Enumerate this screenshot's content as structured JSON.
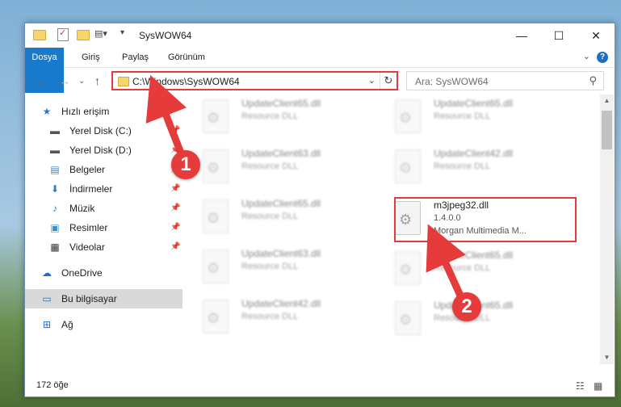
{
  "window": {
    "title": "SysWOW64",
    "controls": {
      "minimize": "—",
      "maximize": "☐",
      "close": "✕"
    }
  },
  "ribbon": {
    "tabs": [
      "Dosya",
      "Giriş",
      "Paylaş",
      "Görünüm"
    ],
    "help": "?"
  },
  "address": {
    "path": "C:\\Windows\\SysWOW64",
    "search_placeholder": "Ara: SysWOW64"
  },
  "sidebar": {
    "quick_access": "Hızlı erişim",
    "items": [
      {
        "label": "Yerel Disk (C:)",
        "icon": "drive-icon",
        "pinned": true
      },
      {
        "label": "Yerel Disk (D:)",
        "icon": "drive-icon",
        "pinned": true
      },
      {
        "label": "Belgeler",
        "icon": "documents-icon",
        "pinned": true
      },
      {
        "label": "İndirmeler",
        "icon": "download-icon",
        "pinned": true
      },
      {
        "label": "Müzik",
        "icon": "music-icon",
        "pinned": true
      },
      {
        "label": "Resimler",
        "icon": "pictures-icon",
        "pinned": true
      },
      {
        "label": "Videolar",
        "icon": "videos-icon",
        "pinned": true
      }
    ],
    "onedrive": "OneDrive",
    "this_pc": "Bu bilgisayar",
    "network": "Ağ"
  },
  "files": [
    {
      "name": "UpdateClient65.dll",
      "type": "Resource DLL",
      "blur": true
    },
    {
      "name": "UpdateClient65.dll",
      "type": "Resource DLL",
      "blur": true
    },
    {
      "name": "UpdateClient63.dll",
      "type": "Resource DLL",
      "blur": true
    },
    {
      "name": "UpdateClient42.dll",
      "type": "Resource DLL",
      "blur": true
    },
    {
      "name": "UpdateClient65.dll",
      "type": "Resource DLL",
      "blur": true
    },
    {
      "name": "m3jpeg32.dll",
      "version": "1.4.0.0",
      "company": "Morgan Multimedia M...",
      "blur": false
    },
    {
      "name": "UpdateClient65.dll",
      "type": "Resource DLL",
      "blur": true
    },
    {
      "name": "UpdateClient63.dll",
      "type": "Resource DLL",
      "blur": true
    },
    {
      "name": "UpdateClient42.dll",
      "type": "Resource DLL",
      "blur": true
    },
    {
      "name": "UpdateClient65.dll",
      "type": "Resource DLL",
      "blur": true
    }
  ],
  "status": {
    "count": "172 öğe"
  },
  "callouts": {
    "one": "1",
    "two": "2"
  },
  "colors": {
    "accent": "#1979ca",
    "highlight": "#e53b3b"
  }
}
